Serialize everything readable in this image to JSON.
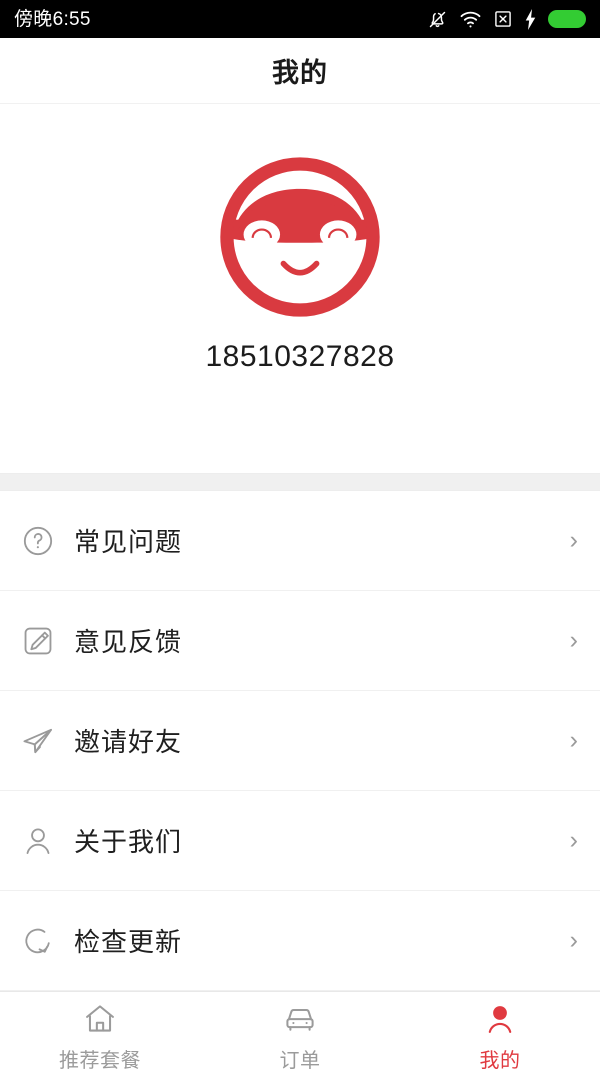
{
  "status_bar": {
    "clock": "傍晚6:55",
    "icons": [
      "notification-off-icon",
      "wifi-icon",
      "no-sim-icon",
      "charging-bolt-icon",
      "battery-icon"
    ],
    "battery_color": "#33cc33",
    "background": "#000000"
  },
  "header": {
    "title": "我的"
  },
  "profile": {
    "avatar_icon": "car-face-avatar",
    "avatar_color": "#d93a40",
    "phone_number": "18510327828"
  },
  "menu": {
    "items": [
      {
        "icon": "question-circle-icon",
        "label": "常见问题",
        "chevron": "›"
      },
      {
        "icon": "edit-pencil-icon",
        "label": "意见反馈",
        "chevron": "›"
      },
      {
        "icon": "paper-plane-icon",
        "label": "邀请好友",
        "chevron": "›"
      },
      {
        "icon": "person-icon",
        "label": "关于我们",
        "chevron": "›"
      },
      {
        "icon": "refresh-icon",
        "label": "检查更新",
        "chevron": "›"
      }
    ]
  },
  "tab_bar": {
    "active_color": "#e03a40",
    "inactive_color": "#9b9b9b",
    "tabs": [
      {
        "icon": "home-icon",
        "label": "推荐套餐",
        "active": false
      },
      {
        "icon": "car-icon",
        "label": "订单",
        "active": false
      },
      {
        "icon": "person-filled-icon",
        "label": "我的",
        "active": true
      }
    ]
  }
}
